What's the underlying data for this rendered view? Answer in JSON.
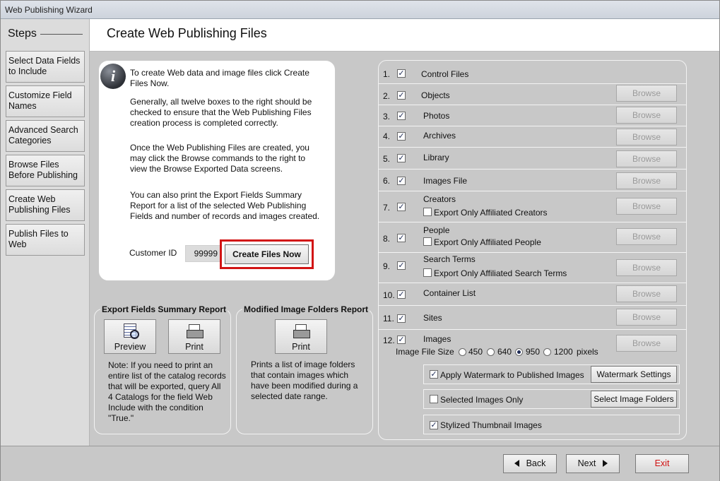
{
  "window": {
    "title": "Web Publishing Wizard"
  },
  "sidebar": {
    "title": "Steps",
    "items": [
      {
        "label": "Select Data Fields to Include"
      },
      {
        "label": "Customize Field Names"
      },
      {
        "label": "Advanced Search Categories"
      },
      {
        "label": "Browse Files Before Publishing"
      },
      {
        "label": "Create Web Publishing Files"
      },
      {
        "label": "Publish Files to Web"
      }
    ]
  },
  "header": {
    "title": "Create Web Publishing Files"
  },
  "info": {
    "paragraphs": [
      "To create Web data and image files click Create Files Now.",
      "Generally, all twelve boxes to the right should be checked to ensure that the Web Publishing Files creation process is completed correctly.",
      "Once the Web Publishing Files are created, you may click the Browse commands to the right to view the Browse Exported Data screens.",
      "You can also print the Export Fields Summary Report for a list of the selected Web Publishing Fields and number of records and images created."
    ],
    "customer_id_label": "Customer ID",
    "customer_id_value": "99999",
    "create_button": "Create Files Now"
  },
  "export_report": {
    "title": "Export Fields Summary Report",
    "preview_label": "Preview",
    "print_label": "Print",
    "note": "Note: If you need to print an entire list of the catalog records that will be exported, query All 4 Catalogs for the field Web Include with the condition \"True.\""
  },
  "image_report": {
    "title": "Modified Image Folders Report",
    "print_label": "Print",
    "note": "Prints a list of image folders that contain images which have been modified during a selected date range."
  },
  "files": {
    "browse_label": "Browse",
    "items": [
      {
        "num": "1.",
        "label": "Control Files",
        "checked": true
      },
      {
        "num": "2.",
        "label": "Objects",
        "checked": true
      },
      {
        "num": "3.",
        "label": "Photos",
        "checked": true
      },
      {
        "num": "4.",
        "label": "Archives",
        "checked": true
      },
      {
        "num": "5.",
        "label": "Library",
        "checked": true
      },
      {
        "num": "6.",
        "label": "Images File",
        "checked": true
      },
      {
        "num": "7.",
        "label": "Creators",
        "checked": true,
        "sub": "Export Only Affiliated Creators"
      },
      {
        "num": "8.",
        "label": "People",
        "checked": true,
        "sub": "Export Only Affiliated People"
      },
      {
        "num": "9.",
        "label": "Search Terms",
        "checked": true,
        "sub": "Export Only Affiliated Search Terms"
      },
      {
        "num": "10.",
        "label": "Container List",
        "checked": true
      },
      {
        "num": "11.",
        "label": "Sites",
        "checked": true
      },
      {
        "num": "12.",
        "label": "Images",
        "checked": true
      }
    ],
    "image_size": {
      "label": "Image File Size",
      "options": [
        "450",
        "640",
        "950",
        "1200"
      ],
      "selected": "950",
      "unit": "pixels"
    },
    "watermark": {
      "label": "Apply Watermark to Published Images",
      "checked": true,
      "button": "Watermark Settings"
    },
    "selected_only": {
      "label": "Selected Images Only",
      "checked": false,
      "button": "Select Image Folders"
    },
    "thumbnails": {
      "label": "Stylized Thumbnail Images",
      "checked": true
    }
  },
  "footer": {
    "back": "Back",
    "next": "Next",
    "exit": "Exit"
  },
  "colors": {
    "exit_text": "#d01010",
    "highlight": "#d21414"
  }
}
